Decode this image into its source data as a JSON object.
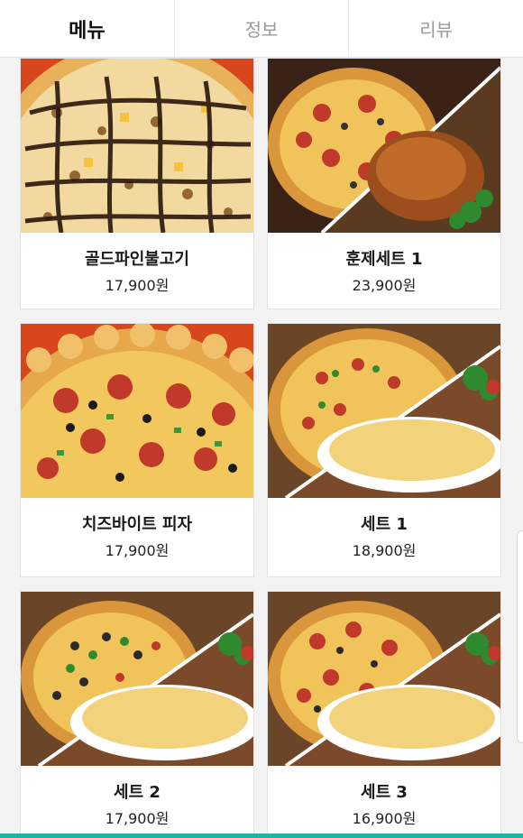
{
  "tabs": [
    {
      "label": "메뉴",
      "active": true
    },
    {
      "label": "정보",
      "active": false
    },
    {
      "label": "리뷰",
      "active": false
    }
  ],
  "menu": [
    {
      "name": "골드파인불고기",
      "price": "17,900원",
      "image": "pizza-bulgogi-image"
    },
    {
      "name": "훈제세트 1",
      "price": "23,900원",
      "image": "pizza-chicken-set-image"
    },
    {
      "name": "치즈바이트 피자",
      "price": "17,900원",
      "image": "pizza-cheese-bite-image"
    },
    {
      "name": "세트 1",
      "price": "18,900원",
      "image": "pizza-gratin-set-image"
    },
    {
      "name": "세트 2",
      "price": "17,900원",
      "image": "pizza-gratin-set-image"
    },
    {
      "name": "세트 3",
      "price": "16,900원",
      "image": "pizza-gratin-set-image"
    }
  ],
  "colors": {
    "accent": "#1fb5a0",
    "crust": "#e2a24a",
    "sauce": "#c0392b",
    "cheese": "#f2d27a"
  }
}
